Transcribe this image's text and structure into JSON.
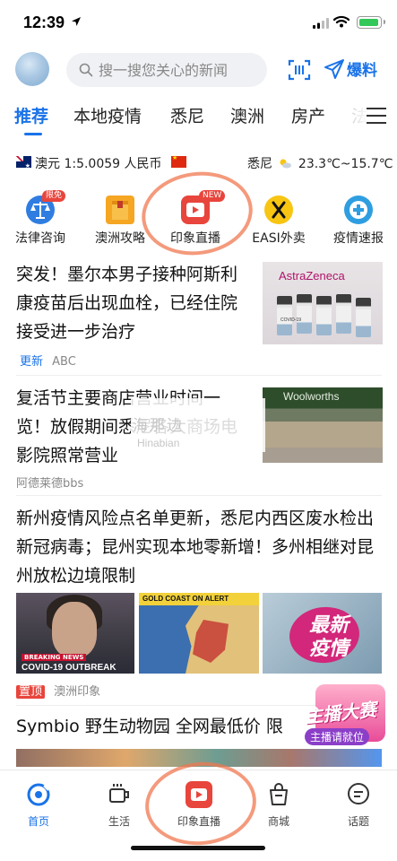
{
  "status": {
    "time": "12:39"
  },
  "header": {
    "search_placeholder": "搜一搜您关心的新闻",
    "hot_label": "爆料"
  },
  "tabs": [
    {
      "label": "推荐"
    },
    {
      "label": "本地疫情"
    },
    {
      "label": "悉尼"
    },
    {
      "label": "澳洲"
    },
    {
      "label": "房产"
    },
    {
      "label": "法"
    }
  ],
  "info": {
    "rate": "澳元 1:5.0059 人民币",
    "city": "悉尼",
    "temp": "23.3℃~15.7℃"
  },
  "quick_links": [
    {
      "label": "法律咨询",
      "badge": "限免",
      "icon": "scales-icon",
      "color": "#2f7de1"
    },
    {
      "label": "澳洲攻略",
      "icon": "guide-book-icon",
      "color": "#f5a623"
    },
    {
      "label": "印象直播",
      "badge": "NEW",
      "icon": "live-play-icon",
      "color": "#e8453c"
    },
    {
      "label": "EASI外卖",
      "icon": "food-delivery-icon",
      "color": "#f7c512"
    },
    {
      "label": "疫情速报",
      "icon": "medical-cross-icon",
      "color": "#2f9ee1"
    }
  ],
  "articles": [
    {
      "title": "突发！墨尔本男子接种阿斯利康疫苗后出现血栓，已经住院接受进一步治疗",
      "tag": "更新",
      "source": "ABC",
      "thumb_text": "AstraZeneca",
      "vial_label": "COVID-19"
    },
    {
      "title": "复活节主要商店营业时间一览！放假期间悉尼各大商场电影院照常营业",
      "source": "阿德莱德bbs",
      "thumb_text": "Woolworths"
    },
    {
      "title": "新州疫情风险点名单更新，悉尼内西区废水检出新冠病毒；昆州实现本地零新增！多州相继对昆州放松边境限制",
      "tag": "置顶",
      "source": "澳洲印象",
      "pics": [
        {
          "breaking": "BREAKING NEWS",
          "caption": "COVID-19 OUTBREAK"
        },
        {
          "caption": "GOLD COAST ON ALERT"
        },
        {
          "caption_line1": "最新",
          "caption_line2": "疫情"
        }
      ]
    },
    {
      "title": "Symbio 野生动物园 全网最低价 限"
    }
  ],
  "watermark": {
    "cn": "海那边",
    "en": "Hinabian"
  },
  "live_float": {
    "title": "主播大赛",
    "subtitle": "主播请就位"
  },
  "bottom_nav": [
    {
      "label": "首页",
      "icon": "home-icon"
    },
    {
      "label": "生活",
      "icon": "coffee-cup-icon"
    },
    {
      "label": "印象直播",
      "icon": "live-play-icon"
    },
    {
      "label": "商城",
      "icon": "shopping-bag-icon"
    },
    {
      "label": "话题",
      "icon": "chat-bubble-icon"
    }
  ],
  "colors": {
    "accent": "#1a73e8",
    "red": "#e8453c",
    "highlight_circle": "#f07850"
  }
}
